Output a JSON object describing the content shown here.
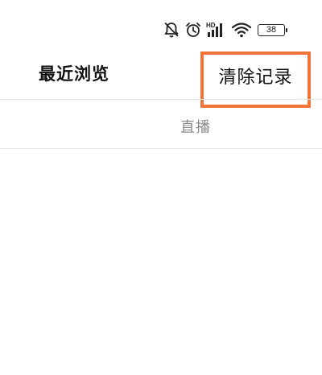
{
  "status_bar": {
    "icons": [
      "mute-bell-icon",
      "alarm-clock-icon",
      "hd-signal-icon",
      "wifi-icon",
      "battery-icon"
    ],
    "hd_label": "HD",
    "battery_level": "38"
  },
  "header": {
    "title": "最近浏览",
    "clear_label": "清除记录",
    "highlight_color": "#f0733a"
  },
  "tabs": {
    "live_label": "直播"
  }
}
